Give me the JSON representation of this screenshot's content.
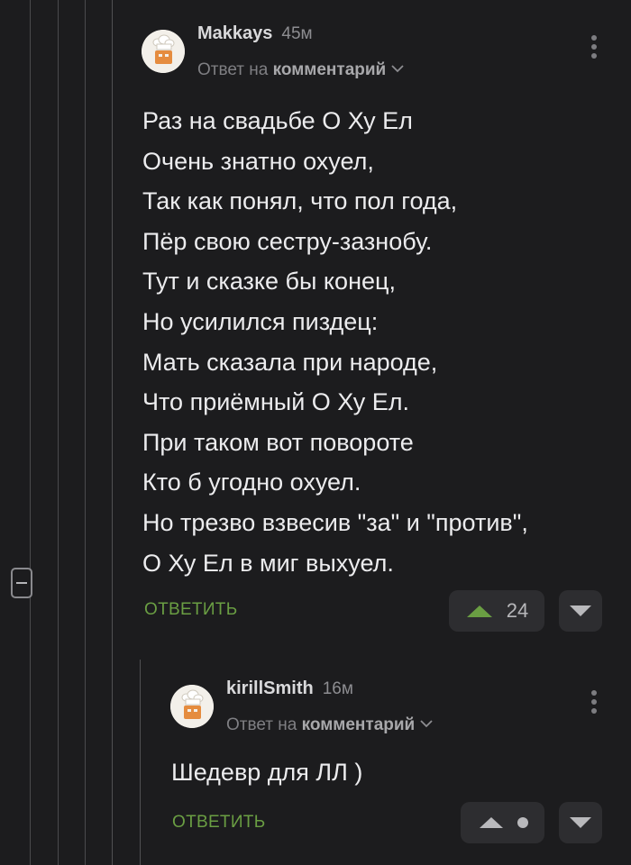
{
  "comment": {
    "author": "Makkays",
    "age": "45м",
    "reply_prefix": "Ответ на",
    "reply_target": "комментарий",
    "lines": [
      "Раз на свадьбе О Ху Ел",
      "Очень знатно охуел,",
      "Так как понял, что пол года,",
      "Пёр свою сестру-зазнобу.",
      "Тут и сказке бы конец,",
      "Но усилился пиздец:",
      "Мать сказала при народе,",
      "Что приёмный О Ху Ел.",
      "При таком вот повороте",
      "Кто б угодно охуел.",
      "Но трезво взвесив \"за\" и \"против\",",
      "О Ху Ел в миг выхуел."
    ],
    "reply_label": "ОТВЕТИТЬ",
    "rating": "24"
  },
  "reply": {
    "author": "kirillSmith",
    "age": "16м",
    "reply_prefix": "Ответ на",
    "reply_target": "комментарий",
    "text": "Шедевр для ЛЛ )",
    "reply_label": "ОТВЕТИТЬ"
  },
  "colors": {
    "background": "#1c1c1e",
    "accent_green": "#6a9e43",
    "vote_bg": "#2d2d30"
  },
  "icons": [
    "avatar-chef",
    "chevron-down-icon",
    "more-vertical-icon",
    "upvote-icon",
    "downvote-icon",
    "collapse-icon"
  ]
}
